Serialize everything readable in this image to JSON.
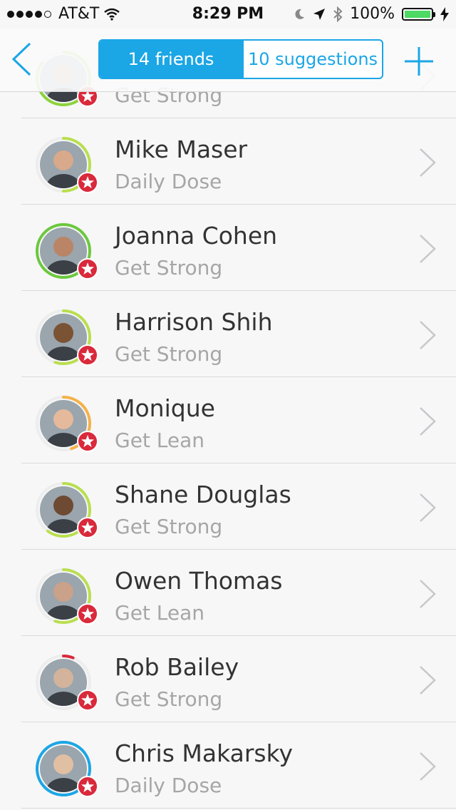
{
  "status_bar": {
    "carrier": "AT&T",
    "time": "8:29 PM",
    "battery": "100%"
  },
  "navbar": {
    "segments": [
      {
        "label": "14 friends",
        "active": true
      },
      {
        "label": "10 suggestions",
        "active": false
      }
    ]
  },
  "friends": [
    {
      "name": "",
      "plan": "Get Strong",
      "ring_color": "#8bd33c",
      "ring_progress": 0.85
    },
    {
      "name": "Mike Maser",
      "plan": "Daily Dose",
      "ring_color": "#b9df4f",
      "ring_progress": 0.5
    },
    {
      "name": "Joanna Cohen",
      "plan": "Get Strong",
      "ring_color": "#6cc83e",
      "ring_progress": 1.0
    },
    {
      "name": "Harrison Shih",
      "plan": "Get Strong",
      "ring_color": "#b9df4f",
      "ring_progress": 0.55
    },
    {
      "name": "Monique",
      "plan": "Get Lean",
      "ring_color": "#f4b24a",
      "ring_progress": 0.45
    },
    {
      "name": "Shane Douglas",
      "plan": "Get Strong",
      "ring_color": "#b9df4f",
      "ring_progress": 0.6
    },
    {
      "name": "Owen Thomas",
      "plan": "Get Lean",
      "ring_color": "#b9df4f",
      "ring_progress": 0.55
    },
    {
      "name": "Rob Bailey",
      "plan": "Get Strong",
      "ring_color": "#d9293b",
      "ring_progress": 0.06
    },
    {
      "name": "Chris Makarsky",
      "plan": "Daily Dose",
      "ring_color": "#1ba6e6",
      "ring_progress": 1.0
    }
  ],
  "colors": {
    "accent": "#1ba6e6",
    "badge": "#d9293b"
  }
}
